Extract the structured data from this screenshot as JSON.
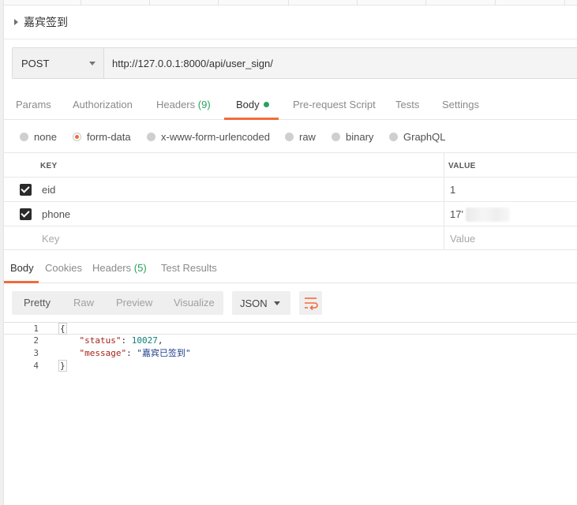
{
  "request": {
    "name": "嘉宾签到",
    "method": "POST",
    "url": "http://127.0.0.1:8000/api/user_sign/"
  },
  "request_tabs": [
    {
      "label": "Params"
    },
    {
      "label": "Authorization"
    },
    {
      "label": "Headers",
      "count": "(9)"
    },
    {
      "label": "Body",
      "active": true,
      "has_dot": true
    },
    {
      "label": "Pre-request Script"
    },
    {
      "label": "Tests"
    },
    {
      "label": "Settings"
    }
  ],
  "body_types": [
    {
      "label": "none",
      "selected": false
    },
    {
      "label": "form-data",
      "selected": true
    },
    {
      "label": "x-www-form-urlencoded",
      "selected": false
    },
    {
      "label": "raw",
      "selected": false
    },
    {
      "label": "binary",
      "selected": false
    },
    {
      "label": "GraphQL",
      "selected": false
    }
  ],
  "form_table": {
    "headers": {
      "key": "KEY",
      "value": "VALUE"
    },
    "rows": [
      {
        "checked": true,
        "key": "eid",
        "value": "1"
      },
      {
        "checked": true,
        "key": "phone",
        "value": "17'"
      }
    ],
    "placeholder": {
      "key": "Key",
      "value": "Value"
    }
  },
  "response_tabs": [
    {
      "label": "Body",
      "active": true
    },
    {
      "label": "Cookies"
    },
    {
      "label": "Headers",
      "count": "(5)"
    },
    {
      "label": "Test Results"
    }
  ],
  "view_modes": [
    {
      "label": "Pretty",
      "active": true
    },
    {
      "label": "Raw"
    },
    {
      "label": "Preview"
    },
    {
      "label": "Visualize"
    }
  ],
  "format": "JSON",
  "wrap_icon": "wrap-lines-icon",
  "response_lines": [
    {
      "num": "1",
      "text": "{"
    },
    {
      "num": "2",
      "key": "\"status\"",
      "value": "10027"
    },
    {
      "num": "3",
      "key": "\"message\"",
      "value": "\"嘉宾已签到\""
    },
    {
      "num": "4",
      "text": "}"
    }
  ],
  "colors": {
    "accent": "#f26b3a",
    "success": "#2aa15a"
  }
}
